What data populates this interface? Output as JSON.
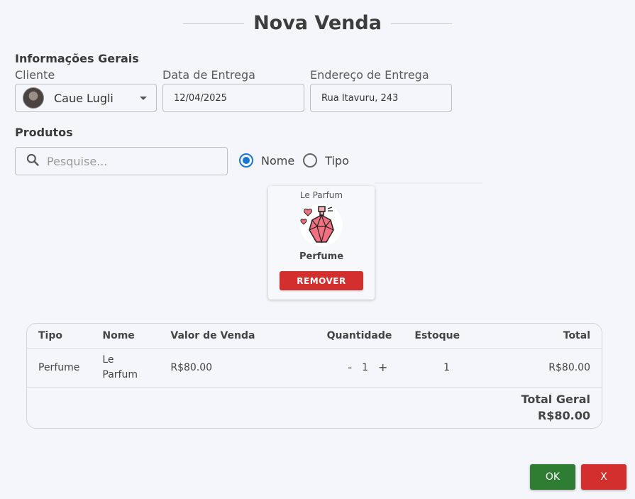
{
  "title": "Nova Venda",
  "general": {
    "section_label": "Informações Gerais",
    "client_label": "Cliente",
    "client_value": "Caue Lugli",
    "date_label": "Data de Entrega",
    "date_value": "12/04/2025",
    "address_label": "Endereço de Entrega",
    "address_value": "Rua Itavuru, 243"
  },
  "products": {
    "section_label": "Produtos",
    "search_placeholder": "Pesquise...",
    "radio_options": [
      {
        "label": "Nome",
        "selected": true
      },
      {
        "label": "Tipo",
        "selected": false
      }
    ],
    "card": {
      "name": "Le Parfum",
      "type": "Perfume",
      "remove_label": "REMOVER",
      "icon": "perfume-bottle-icon"
    }
  },
  "table": {
    "headers": [
      "Tipo",
      "Nome",
      "Valor de Venda",
      "Quantidade",
      "Estoque",
      "Total"
    ],
    "rows": [
      {
        "tipo": "Perfume",
        "nome": "Le Parfum",
        "valor": "R$80.00",
        "qtd": "1",
        "estoque": "1",
        "total": "R$80.00"
      }
    ],
    "minus": "-",
    "plus": "+",
    "total_label": "Total Geral",
    "total_value": "R$80.00"
  },
  "actions": {
    "ok_label": "OK",
    "cancel_label": "X"
  },
  "colors": {
    "background": "#f5f6fb",
    "primary_radio": "#1976d2",
    "danger": "#d32f2f",
    "success": "#2e7d32"
  }
}
